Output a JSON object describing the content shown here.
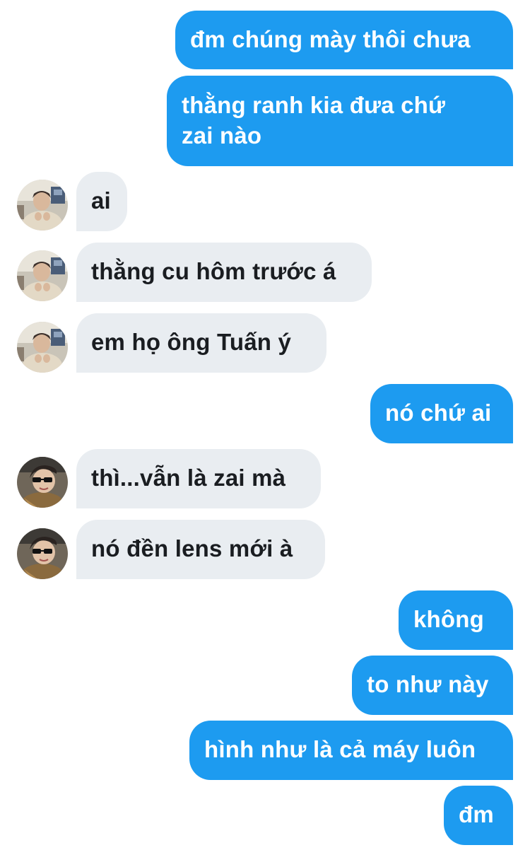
{
  "conversation": {
    "messages": [
      {
        "direction": "sent",
        "text": "đm chúng mày thôi chưa"
      },
      {
        "direction": "sent",
        "text_lines": [
          "thằng ranh kia đưa chứ",
          "zai nào"
        ]
      },
      {
        "direction": "received",
        "avatar": "boy-avatar-icon",
        "text": "ai"
      },
      {
        "direction": "received",
        "avatar": "boy-avatar-icon",
        "text": "thằng cu hôm trước á"
      },
      {
        "direction": "received",
        "avatar": "boy-avatar-icon",
        "text": "em họ ông Tuấn ý"
      },
      {
        "direction": "sent",
        "text": "nó chứ ai"
      },
      {
        "direction": "received",
        "avatar": "sunglasses-avatar-icon",
        "text": "thì...vẫn là zai mà"
      },
      {
        "direction": "received",
        "avatar": "sunglasses-avatar-icon",
        "text": "nó đền lens mới à"
      },
      {
        "direction": "sent",
        "text": "không"
      },
      {
        "direction": "sent",
        "text": "to như này"
      },
      {
        "direction": "sent",
        "text": "hình như là cả máy luôn"
      },
      {
        "direction": "sent",
        "text": "đm"
      }
    ]
  },
  "colors": {
    "sent_bubble": "#1d9bf0",
    "received_bubble": "#e9edf1",
    "sent_text": "#ffffff",
    "received_text": "#1a1d21",
    "background": "#ffffff"
  }
}
